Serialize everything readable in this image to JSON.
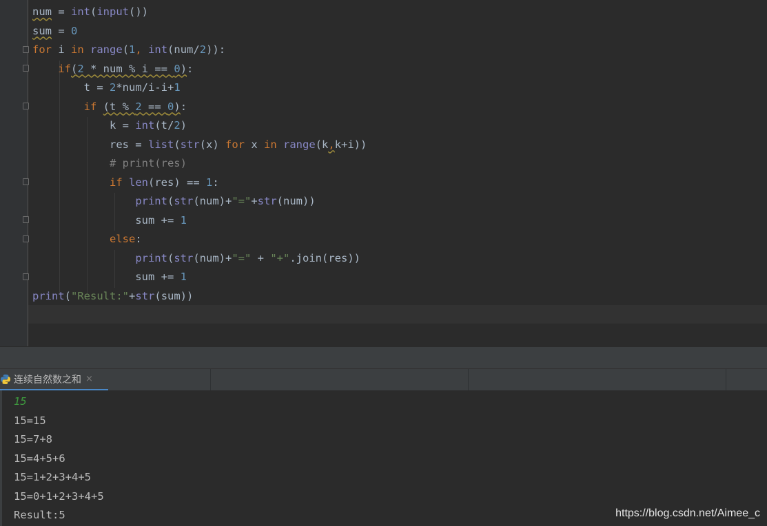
{
  "editor": {
    "lines": [
      [
        {
          "t": "num",
          "c": "wavy"
        },
        {
          "t": " = ",
          "c": ""
        },
        {
          "t": "int",
          "c": "bi"
        },
        {
          "t": "(",
          "c": ""
        },
        {
          "t": "input",
          "c": "bi"
        },
        {
          "t": "())",
          "c": ""
        }
      ],
      [
        {
          "t": "sum",
          "c": "wavy"
        },
        {
          "t": " = ",
          "c": ""
        },
        {
          "t": "0",
          "c": "num"
        }
      ],
      [
        {
          "t": "for",
          "c": "kw"
        },
        {
          "t": " i ",
          "c": ""
        },
        {
          "t": "in",
          "c": "kw"
        },
        {
          "t": " ",
          "c": ""
        },
        {
          "t": "range",
          "c": "bi"
        },
        {
          "t": "(",
          "c": ""
        },
        {
          "t": "1",
          "c": "num"
        },
        {
          "t": ", ",
          "c": "kw"
        },
        {
          "t": "int",
          "c": "bi"
        },
        {
          "t": "(num/",
          "c": ""
        },
        {
          "t": "2",
          "c": "num"
        },
        {
          "t": ")):",
          "c": ""
        }
      ],
      [
        {
          "t": "    ",
          "c": ""
        },
        {
          "t": "if",
          "c": "kw"
        },
        {
          "t": "(",
          "c": "wavy"
        },
        {
          "t": "2",
          "c": "num wavy"
        },
        {
          "t": " * num % i == ",
          "c": "wavy"
        },
        {
          "t": "0",
          "c": "num wavy"
        },
        {
          "t": ")",
          "c": "wavy"
        },
        {
          "t": ":",
          "c": ""
        }
      ],
      [
        {
          "t": "        t = ",
          "c": ""
        },
        {
          "t": "2",
          "c": "num"
        },
        {
          "t": "*num/i-i+",
          "c": ""
        },
        {
          "t": "1",
          "c": "num"
        }
      ],
      [
        {
          "t": "        ",
          "c": ""
        },
        {
          "t": "if",
          "c": "kw"
        },
        {
          "t": " ",
          "c": ""
        },
        {
          "t": "(t % ",
          "c": "wavy"
        },
        {
          "t": "2",
          "c": "num wavy"
        },
        {
          "t": " == ",
          "c": "wavy"
        },
        {
          "t": "0",
          "c": "num wavy"
        },
        {
          "t": ")",
          "c": "wavy"
        },
        {
          "t": ":",
          "c": ""
        }
      ],
      [
        {
          "t": "            k = ",
          "c": ""
        },
        {
          "t": "int",
          "c": "bi"
        },
        {
          "t": "(t/",
          "c": ""
        },
        {
          "t": "2",
          "c": "num"
        },
        {
          "t": ")",
          "c": ""
        }
      ],
      [
        {
          "t": "            res = ",
          "c": ""
        },
        {
          "t": "list",
          "c": "bi"
        },
        {
          "t": "(",
          "c": ""
        },
        {
          "t": "str",
          "c": "bi"
        },
        {
          "t": "(x) ",
          "c": ""
        },
        {
          "t": "for",
          "c": "kw"
        },
        {
          "t": " x ",
          "c": ""
        },
        {
          "t": "in",
          "c": "kw"
        },
        {
          "t": " ",
          "c": ""
        },
        {
          "t": "range",
          "c": "bi"
        },
        {
          "t": "(k",
          "c": ""
        },
        {
          "t": ",",
          "c": "kw wavy"
        },
        {
          "t": "k+i))",
          "c": ""
        }
      ],
      [
        {
          "t": "            ",
          "c": ""
        },
        {
          "t": "# print(res)",
          "c": "cm"
        }
      ],
      [
        {
          "t": "            ",
          "c": ""
        },
        {
          "t": "if",
          "c": "kw"
        },
        {
          "t": " ",
          "c": ""
        },
        {
          "t": "len",
          "c": "bi"
        },
        {
          "t": "(res) == ",
          "c": ""
        },
        {
          "t": "1",
          "c": "num"
        },
        {
          "t": ":",
          "c": ""
        }
      ],
      [
        {
          "t": "                ",
          "c": ""
        },
        {
          "t": "print",
          "c": "bi"
        },
        {
          "t": "(",
          "c": ""
        },
        {
          "t": "str",
          "c": "bi"
        },
        {
          "t": "(num)+",
          "c": ""
        },
        {
          "t": "\"=\"",
          "c": "str"
        },
        {
          "t": "+",
          "c": ""
        },
        {
          "t": "str",
          "c": "bi"
        },
        {
          "t": "(num))",
          "c": ""
        }
      ],
      [
        {
          "t": "                sum += ",
          "c": ""
        },
        {
          "t": "1",
          "c": "num"
        }
      ],
      [
        {
          "t": "            ",
          "c": ""
        },
        {
          "t": "else",
          "c": "kw"
        },
        {
          "t": ":",
          "c": ""
        }
      ],
      [
        {
          "t": "                ",
          "c": ""
        },
        {
          "t": "print",
          "c": "bi"
        },
        {
          "t": "(",
          "c": ""
        },
        {
          "t": "str",
          "c": "bi"
        },
        {
          "t": "(num)+",
          "c": ""
        },
        {
          "t": "\"=\"",
          "c": "str"
        },
        {
          "t": " + ",
          "c": ""
        },
        {
          "t": "\"+\"",
          "c": "str"
        },
        {
          "t": ".join(res))",
          "c": ""
        }
      ],
      [
        {
          "t": "                sum += ",
          "c": ""
        },
        {
          "t": "1",
          "c": "num"
        }
      ],
      [
        {
          "t": "print",
          "c": "bi"
        },
        {
          "t": "(",
          "c": ""
        },
        {
          "t": "\"Result:\"",
          "c": "str"
        },
        {
          "t": "+",
          "c": ""
        },
        {
          "t": "str",
          "c": "bi"
        },
        {
          "t": "(sum))",
          "c": ""
        }
      ]
    ]
  },
  "run": {
    "tab_label": "连续自然数之和",
    "close_glyph": "×",
    "icon": "python-icon",
    "output": [
      "15",
      "15=15",
      "15=7+8",
      "15=4+5+6",
      "15=1+2+3+4+5",
      "15=0+1+2+3+4+5",
      "Result:5"
    ]
  },
  "watermark": "https://blog.csdn.net/Aimee_c",
  "colors": {
    "keyword": "#cc7832",
    "builtin": "#8888c6",
    "number": "#6897bb",
    "string": "#6a8759",
    "comment": "#808080",
    "text": "#a9b7c6",
    "input_echo": "#3e9a3e",
    "tab_accent": "#4a88c7"
  }
}
